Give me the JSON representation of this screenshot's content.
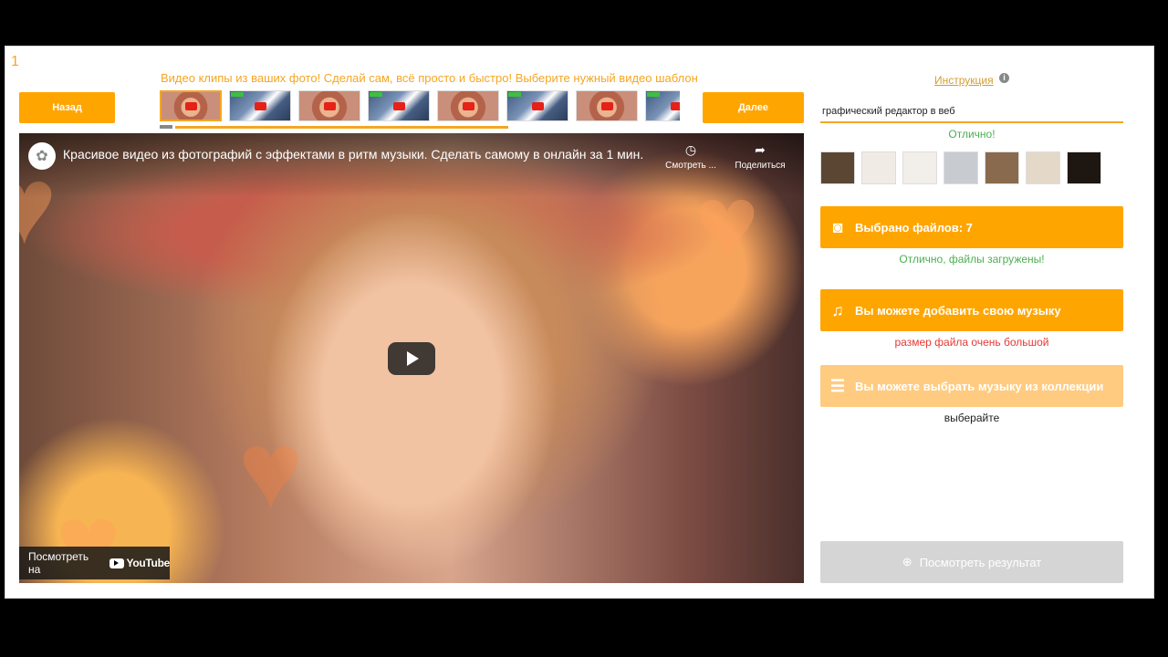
{
  "step_number": "1",
  "headline": "Видео клипы из ваших фото! Сделай сам, всё просто и быстро! Выберите нужный видео шаблон",
  "nav": {
    "back_label": "Назад",
    "next_label": "Далее"
  },
  "templates": [
    {
      "kind": "girl",
      "active": true
    },
    {
      "kind": "street",
      "active": false
    },
    {
      "kind": "girl",
      "active": false
    },
    {
      "kind": "street",
      "active": false
    },
    {
      "kind": "girl",
      "active": false
    },
    {
      "kind": "street",
      "active": false
    },
    {
      "kind": "girl",
      "active": false
    },
    {
      "kind": "street",
      "active": false
    }
  ],
  "video": {
    "title": "Красивое видео из фотографий с эффектами в ритм музыки. Сделать самому в онлайн за 1 мин.",
    "watch_later": "Смотреть ...",
    "share": "Поделиться",
    "watch_on": "Посмотреть на",
    "youtube": "YouTube"
  },
  "sidebar": {
    "instruction_link": "Инструкция",
    "info_icon": "i",
    "search_value": "графический редактор в веб",
    "search_ok": "Отлично!",
    "photos": [
      "#5a4632",
      "#f0ebe5",
      "#f2efea",
      "#c8ccd0",
      "#8a6a4e",
      "#e4d9c8",
      "#1e1610"
    ],
    "files_button": "Выбрано файлов: 7",
    "files_ok": "Отлично, файлы загружены!",
    "music_button": "Вы можете добавить свою музыку",
    "music_error": "размер файла очень большой",
    "collection_button": "Вы можете выбрать музыку из коллекции",
    "collection_hint": "выберайте",
    "result_button": "Посмотреть результат"
  },
  "colors": {
    "accent": "#ffa500",
    "accent_light": "#ffcb80",
    "success": "#4caf50",
    "error": "#e53935"
  }
}
